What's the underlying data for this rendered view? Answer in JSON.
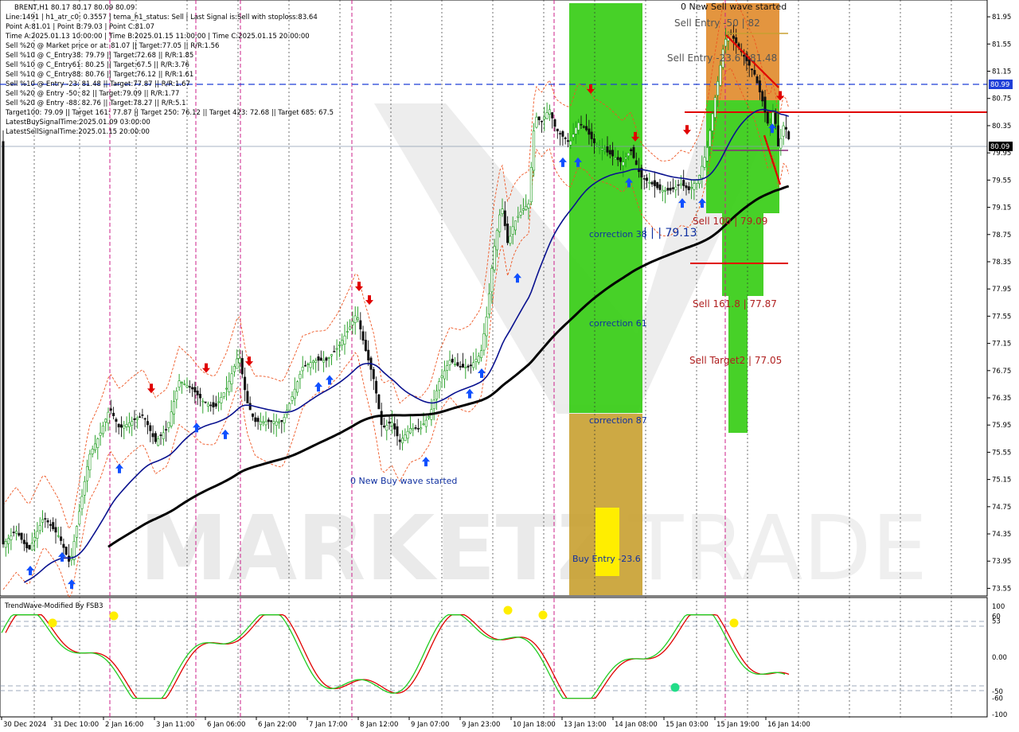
{
  "window": {
    "symbol_line": "BRENT,H1  80.17 80.17 80.09 80.09"
  },
  "info_lines": [
    "Line:1491  |  h1_atr_c0: 0.3557  |  tema_h1_status: Sell  |  Last Signal is:Sell with stoploss:83.64",
    "Point A:81.01  |  Point B:79.03  |  Point C:81.07",
    "Time A:2025.01.13 10:00:00  |  Time B:2025.01.15 11:00:00  |  Time C:2025.01.15 20:00:00",
    "Sell %20 @ Market price or at: 81.07  ||  Target:77.05  ||  R/R:1.56",
    "Sell %10 @ C_Entry38: 79.79  ||  Target:72.68  ||  R/R:1.85",
    "Sell %10 @ C_Entry61: 80.25  ||  Target:67.5  ||  R/R:3.76",
    "Sell %10 @ C_Entry88: 80.76  ||  Target:76.12  ||  R/R:1.61",
    "Sell %10 @ Entry -23: 81.48  ||  Target:77.87  ||  R/R:1.67",
    "Sell %20 @ Entry -50: 82  ||  Target:79.09  ||  R/R:1.77",
    "Sell %20 @ Entry -88: 82.76  ||  Target:78.27  ||  R/R:5.1",
    "Target100: 79.09  ||  Target 161: 77.87  ||  Target 250: 76.12  ||  Target 423: 72.68  ||  Target 685: 67.5",
    "LatestBuySignalTime:2025.01.09 03:00:00",
    "LatestSellSignalTime:2025.01.15 20:00:00"
  ],
  "price_axis": {
    "ticks": [
      "81.95",
      "81.55",
      "81.15",
      "80.75",
      "80.35",
      "79.95",
      "79.55",
      "79.15",
      "78.75",
      "78.35",
      "77.95",
      "77.55",
      "77.15",
      "76.75",
      "76.35",
      "75.95",
      "75.55",
      "75.15",
      "74.75",
      "74.35",
      "73.95",
      "73.55"
    ],
    "current_price": "80.09",
    "level_label": "80.99",
    "current_color": "#000000",
    "level_color": "#1f3fd8"
  },
  "time_axis": {
    "ticks": [
      "30 Dec 2024",
      "31 Dec 10:00",
      "2 Jan 16:00",
      "3 Jan 11:00",
      "6 Jan 06:00",
      "6 Jan 22:00",
      "7 Jan 17:00",
      "8 Jan 12:00",
      "9 Jan 07:00",
      "9 Jan 23:00",
      "10 Jan 18:00",
      "13 Jan 13:00",
      "14 Jan 08:00",
      "15 Jan 03:00",
      "15 Jan 19:00",
      "16 Jan 14:00"
    ]
  },
  "annotations": {
    "new_sell_wave": "0 New Sell wave started",
    "new_buy_wave": "0 New Buy wave started",
    "sell_entry_50": "Sell Entry -50 | 82",
    "sell_entry_23": "Sell Entry -23.6 | 81.48",
    "sell_100": "Sell 100 | 79.09",
    "sell_161": "Sell 161.8 | 77.87",
    "sell_target2": "Sell Target2 | 77.05",
    "correction_38": "correction 38",
    "correction_61": "correction 61",
    "correction_87": "correction 87",
    "buy_entry": "Buy Entry -23.6",
    "mid_level": "| | | 79.13"
  },
  "watermark": {
    "left": "MARKETZ",
    "right": "TRADE"
  },
  "indicator": {
    "title": "TrendWave-Modified By FSB3",
    "ticks": [
      "100",
      "60",
      "53",
      "0.00",
      "-50",
      "-60",
      "-100"
    ]
  },
  "colors": {
    "green_zone": "#33cc11",
    "orange_zone": "#e08a2a",
    "gold_zone": "#c8a030",
    "yellow_box": "#ffee00",
    "ma_blue": "#0a128f",
    "ma_black": "#000000",
    "sell_red": "#e00000",
    "buy_blue": "#1050ff",
    "bull_candle": "#1a9a1a",
    "bear_candle": "#111111"
  },
  "chart_data": {
    "type": "candlestick",
    "symbol": "BRENT",
    "timeframe": "H1",
    "price_range": [
      73.45,
      82.15
    ],
    "current_price": 80.09,
    "levels": [
      {
        "label": "80.99",
        "value": 80.99,
        "style": "dashed",
        "color": "#1f3fd8"
      },
      {
        "value": 80.62,
        "style": "solid",
        "color": "#e00000"
      },
      {
        "value": 78.35,
        "style": "solid",
        "color": "#e00000"
      }
    ],
    "close_path": [
      {
        "t": "30 Dec 2024",
        "close": 74.2
      },
      {
        "t": "31 Dec 10:00",
        "close": 74.4
      },
      {
        "t": "2 Jan 16:00",
        "close": 75.9
      },
      {
        "t": "3 Jan 11:00",
        "close": 75.7
      },
      {
        "t": "6 Jan 06:00",
        "close": 76.5
      },
      {
        "t": "6 Jan 22:00",
        "close": 76.1
      },
      {
        "t": "7 Jan 17:00",
        "close": 76.9
      },
      {
        "t": "8 Jan 12:00",
        "close": 77.4
      },
      {
        "t": "9 Jan 07:00",
        "close": 75.6
      },
      {
        "t": "9 Jan 23:00",
        "close": 76.8
      },
      {
        "t": "10 Jan 18:00",
        "close": 79.2
      },
      {
        "t": "13 Jan 13:00",
        "close": 80.3
      },
      {
        "t": "14 Jan 08:00",
        "close": 79.9
      },
      {
        "t": "15 Jan 03:00",
        "close": 79.5
      },
      {
        "t": "15 Jan 19:00",
        "close": 81.6
      },
      {
        "t": "16 Jan 14:00",
        "close": 80.1
      }
    ],
    "oscillator_range": [
      -100,
      100
    ]
  }
}
